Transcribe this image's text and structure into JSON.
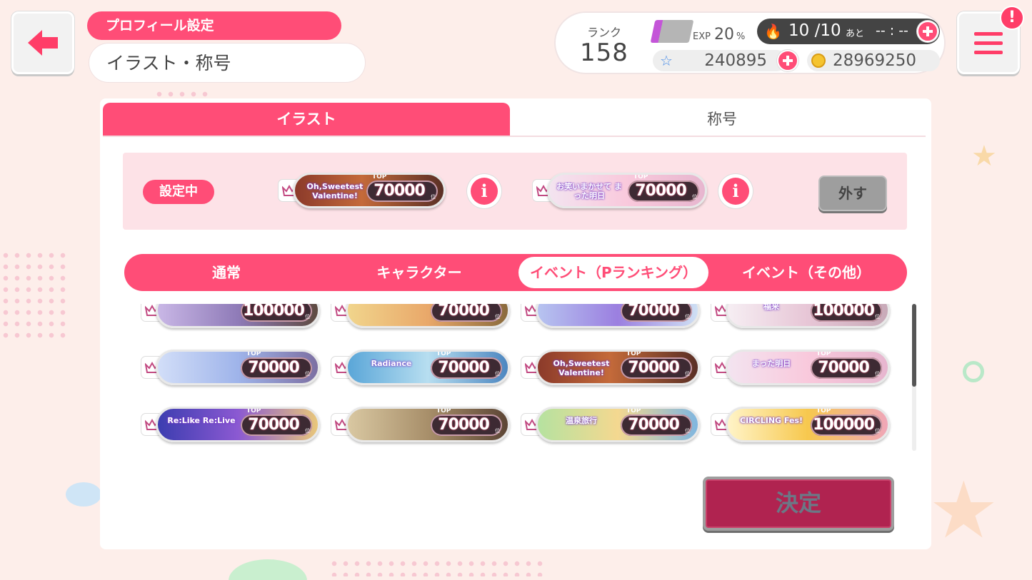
{
  "header": {
    "section_label": "プロフィール設定",
    "page_title": "イラスト・称号",
    "notification_mark": "!"
  },
  "status": {
    "rank_label": "ランク",
    "rank_value": "158",
    "exp_label": "EXP",
    "exp_percent": "20",
    "exp_unit": "%",
    "exp_progress": 0.2,
    "stamina": "10 /10",
    "stamina_until": "あと",
    "stamina_timer": "-- : --",
    "gems": "240895",
    "coins": "28969250"
  },
  "tabs": [
    {
      "label": "イラスト",
      "active": true
    },
    {
      "label": "称号",
      "active": false
    }
  ],
  "current": {
    "badge": "設定中",
    "remove_label": "外す",
    "info_mark": "i",
    "titles": [
      {
        "art": "Oh,Sweetest Valentine!",
        "top": "TOP",
        "rank": "70000",
        "unit": "位"
      },
      {
        "art": "お笑いまかせて まった明日",
        "top": "TOP",
        "rank": "70000",
        "unit": "位"
      }
    ]
  },
  "categories": [
    {
      "label": "通常",
      "active": false
    },
    {
      "label": "キャラクター",
      "active": false
    },
    {
      "label": "イベント（Pランキング）",
      "active": true
    },
    {
      "label": "イベント（その他）",
      "active": false
    }
  ],
  "title_grid": [
    {
      "art": "",
      "top": "",
      "rank": "100000",
      "unit": "位"
    },
    {
      "art": "",
      "top": "",
      "rank": "70000",
      "unit": "位"
    },
    {
      "art": "",
      "top": "",
      "rank": "70000",
      "unit": "位"
    },
    {
      "art": "福来",
      "top": "",
      "rank": "100000",
      "unit": "位"
    },
    {
      "art": "",
      "top": "TOP",
      "rank": "70000",
      "unit": "位"
    },
    {
      "art": "Radiance",
      "top": "TOP",
      "rank": "70000",
      "unit": "位"
    },
    {
      "art": "Oh,Sweetest Valentine!",
      "top": "TOP",
      "rank": "70000",
      "unit": "位"
    },
    {
      "art": "まった明日",
      "top": "TOP",
      "rank": "70000",
      "unit": "位"
    },
    {
      "art": "Re:Like Re:Live",
      "top": "TOP",
      "rank": "70000",
      "unit": "位"
    },
    {
      "art": "",
      "top": "TOP",
      "rank": "70000",
      "unit": "位"
    },
    {
      "art": "温泉旅行",
      "top": "TOP",
      "rank": "70000",
      "unit": "位"
    },
    {
      "art": "CIRCLING Fes!",
      "top": "TOP",
      "rank": "100000",
      "unit": "位"
    }
  ],
  "confirm_label": "決定",
  "colors": {
    "accent": "#ff4d77",
    "confirm": "#b02350",
    "background": "#fdeeea"
  }
}
